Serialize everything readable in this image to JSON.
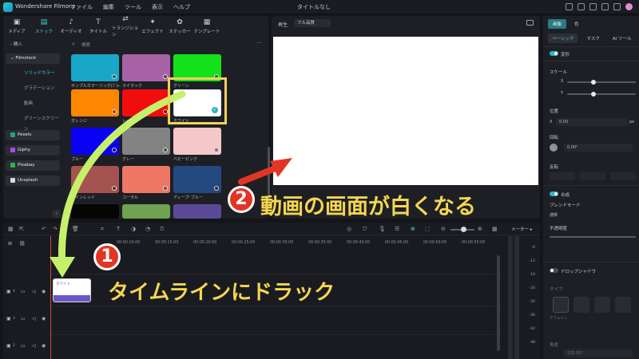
{
  "titlebar": {
    "app_name": "Wondershare Filmora",
    "menu": [
      "ファイル",
      "編集",
      "ツール",
      "表示",
      "ヘルプ"
    ],
    "doc_title": "タイトルなし"
  },
  "media": {
    "tabs": [
      {
        "label": "メディア",
        "icon": "▣"
      },
      {
        "label": "ストック",
        "icon": "▤"
      },
      {
        "label": "オーディオ",
        "icon": "♪"
      },
      {
        "label": "タイトル",
        "icon": "T"
      },
      {
        "label": "トランジション",
        "icon": "⇄"
      },
      {
        "label": "エフェクト",
        "icon": "✦"
      },
      {
        "label": "ステッカー",
        "icon": "✿"
      },
      {
        "label": "テンプレート",
        "icon": "▦"
      }
    ],
    "sidebar": {
      "items": [
        {
          "label": "購入"
        },
        {
          "label": "Filmstock"
        },
        {
          "label": "ソリッドカラー"
        },
        {
          "label": "グラデーション"
        },
        {
          "label": "動画"
        },
        {
          "label": "グリーンスクリーン"
        },
        {
          "label": "Pexels"
        },
        {
          "label": "Giphy"
        },
        {
          "label": "Pixabay"
        },
        {
          "label": "Unsplash"
        }
      ]
    },
    "search_placeholder": "検索",
    "tiles": [
      {
        "label": "サンプルカラーリング(ﾌﾞﾙｰ",
        "color": "#19a7c7"
      },
      {
        "label": "ライラック",
        "color": "#a763a6"
      },
      {
        "label": "グリーン",
        "color": "#13e11a"
      },
      {
        "label": "オレンジ",
        "color": "#ff8600"
      },
      {
        "label": "レッド",
        "color": "#f10d0d"
      },
      {
        "label": "ホワイト",
        "color": "#ffffff"
      },
      {
        "label": "ブルー",
        "color": "#0a00f4"
      },
      {
        "label": "グレー",
        "color": "#838383"
      },
      {
        "label": "ベビーピンク",
        "color": "#f4c7c9"
      },
      {
        "label": "ワインレッド",
        "color": "#a5534f"
      },
      {
        "label": "コーラル",
        "color": "#f07765"
      },
      {
        "label": "ディープ･ブルー",
        "color": "#24497f"
      }
    ],
    "partial_tiles": [
      "#050505",
      "#6fa251",
      "#5a4a98"
    ]
  },
  "preview": {
    "play_label": "再生",
    "quality": "フル品質"
  },
  "inspector": {
    "tabs": [
      "画像",
      "色"
    ],
    "subtabs": [
      "ベーシック",
      "マスク",
      "AI ツール"
    ],
    "transform_label": "変形",
    "scale_label": "スケール",
    "x_label": "X",
    "y_label": "Y",
    "position_label": "位置",
    "pos_x_value": "0.00",
    "pos_unit": "px",
    "rotation_label": "回転",
    "rotation_value": "0.00°",
    "flip_label": "反転",
    "blend_label": "合成",
    "blend_mode_label": "ブレンドモード",
    "blend_mode_value": "通常",
    "opacity_label": "不透明度",
    "shadow_label": "ドロップシャドウ",
    "type_label": "タイプ",
    "chip_label": "デフォルト",
    "angle_label": "角度",
    "angle_value": "135.00°"
  },
  "timeline": {
    "ruler_labels": [
      "00:00:10:00",
      "00:00:15:00",
      "00:00:20:00",
      "00:00:25:00",
      "00:00:30:00",
      "00:00:35:00",
      "00:00:40:00",
      "00:00:45:00",
      "00:00:50:00",
      "00:00:55:00"
    ],
    "meter_label": "メーター ▸",
    "tracks": [
      {
        "num": "4"
      },
      {
        "num": "3"
      },
      {
        "num": "2"
      }
    ],
    "clip_label": "ホワイト",
    "vu_labels": [
      "-6",
      "-12",
      "-18",
      "-24",
      "-30",
      "-36",
      "-42",
      "-48"
    ]
  },
  "annotations": {
    "step1_number": "1",
    "step1_text": "タイムラインにドラック",
    "step2_number": "2",
    "step2_text": "動画の画面が白くなる",
    "highlight_color": "#f0d35a",
    "arrow_color": "#c6f06a"
  }
}
